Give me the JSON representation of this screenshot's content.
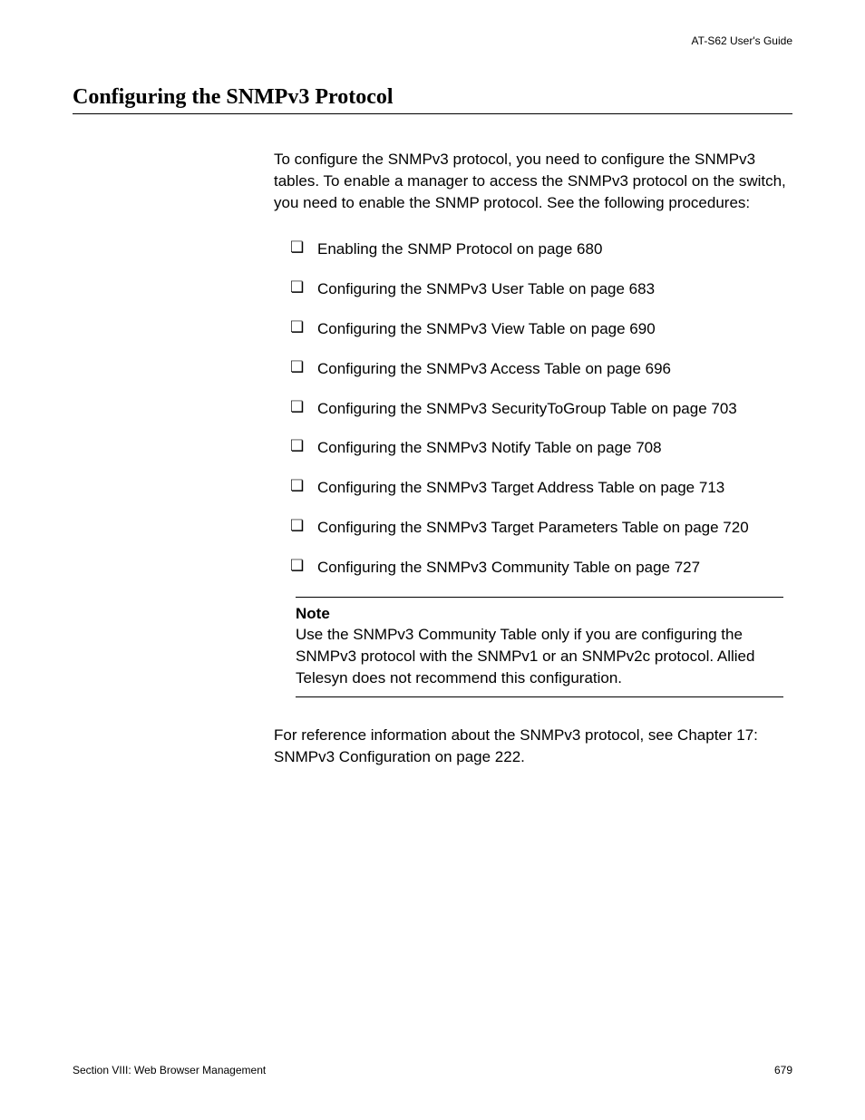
{
  "header": {
    "right": "AT-S62  User's Guide"
  },
  "title": "Configuring the SNMPv3 Protocol",
  "intro": "To configure the SNMPv3 protocol, you need to configure the SNMPv3 tables. To enable a manager to access the SNMPv3 protocol on the switch, you need to enable the SNMP protocol. See the following procedures:",
  "items": [
    "Enabling the SNMP Protocol on page 680",
    "Configuring the SNMPv3 User Table on page 683",
    "Configuring the SNMPv3 View Table on page 690",
    "Configuring the SNMPv3 Access Table on page 696",
    "Configuring the SNMPv3 SecurityToGroup Table on page 703",
    "Configuring the SNMPv3 Notify Table on page 708",
    "Configuring the SNMPv3 Target Address Table on page 713",
    "Configuring the SNMPv3 Target Parameters Table on page 720",
    "Configuring the SNMPv3 Community Table on page 727"
  ],
  "note": {
    "label": "Note",
    "text": "Use the SNMPv3 Community Table only if you are configuring the SNMPv3 protocol with the SNMPv1 or an SNMPv2c protocol. Allied Telesyn does not recommend this configuration."
  },
  "afterNote": "For reference information about the SNMPv3 protocol, see Chapter 17: SNMPv3 Configuration on page 222.",
  "footer": {
    "left": "Section VIII: Web Browser Management",
    "right": "679"
  }
}
